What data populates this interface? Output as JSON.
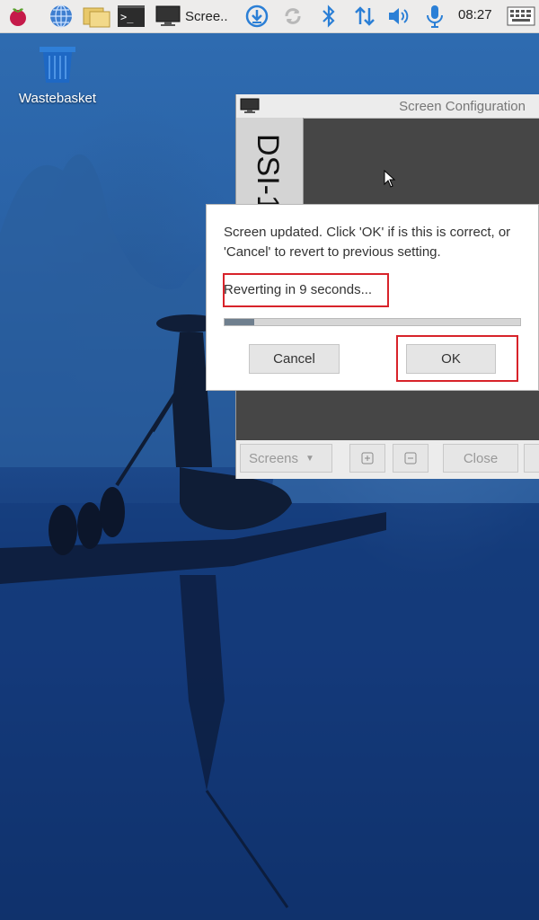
{
  "taskbar": {
    "task_title": "Scree..",
    "clock": "08:27",
    "icons": [
      "raspberry-menu-icon",
      "web-browser-icon",
      "file-manager-icon",
      "terminal-icon",
      "monitor-icon",
      "download-icon",
      "sync-icon",
      "bluetooth-icon",
      "network-icon",
      "volume-icon",
      "microphone-icon",
      "keyboard-icon"
    ],
    "terminal_glyph": ">_"
  },
  "desktop": {
    "icons": [
      {
        "label": "Wastebasket",
        "icon": "trash-icon"
      }
    ]
  },
  "screen_config": {
    "title": "Screen Configuration",
    "display_tab": "DSI-1",
    "toolbar": {
      "screens_label": "Screens",
      "close_label": "Close"
    }
  },
  "dialog": {
    "message": "Screen updated. Click 'OK' if is this is correct, or 'Cancel' to revert to previous setting.",
    "countdown": "Reverting in 9 seconds...",
    "progress_fraction": 0.1,
    "cancel_label": "Cancel",
    "ok_label": "OK"
  },
  "colors": {
    "highlight": "#d8232a",
    "taskbar_bg": "#edeceb",
    "window_bg": "#464646"
  }
}
